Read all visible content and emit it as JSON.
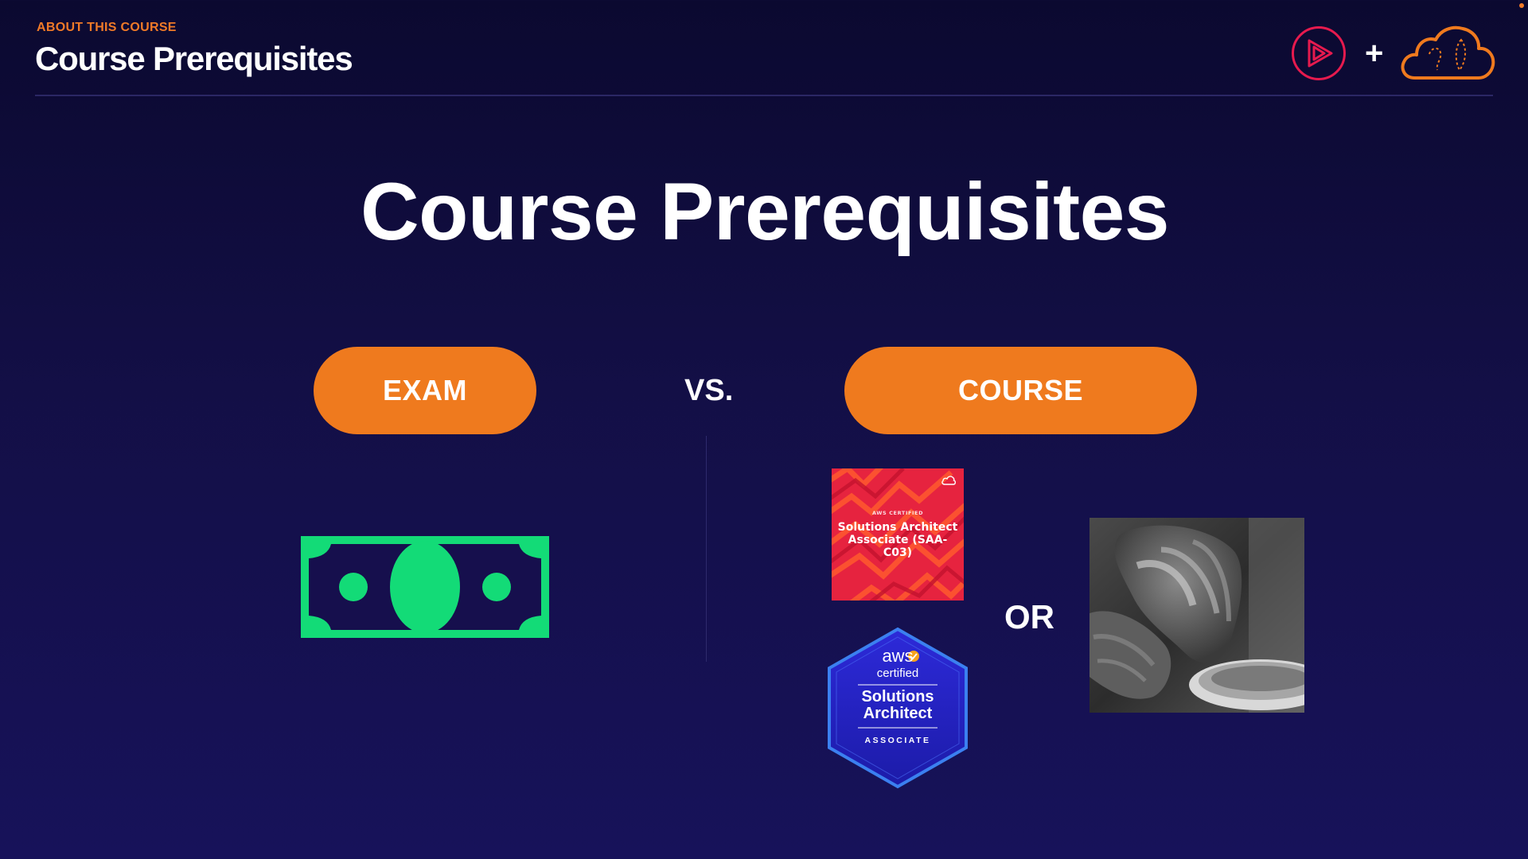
{
  "header": {
    "eyebrow": "ABOUT THIS COURSE",
    "title": "Course Prerequisites",
    "plus": "+"
  },
  "slide": {
    "title": "Course Prerequisites",
    "exam_label": "EXAM",
    "vs_label": "VS.",
    "course_label": "COURSE",
    "or_label": "OR"
  },
  "course_card": {
    "small_text": "AWS CERTIFIED",
    "title": "Solutions Architect Associate (SAA-C03)"
  },
  "badge": {
    "brand": "aws",
    "certified": "certified",
    "title": "Solutions Architect",
    "level": "ASSOCIATE"
  },
  "icons": {
    "logo_left": "pluralsight-play-logo",
    "logo_right": "cloud-guru-cloud-logo",
    "money": "dollar-bill-icon",
    "photo": "pottery-hands-photo"
  },
  "colors": {
    "accent_orange": "#ef7a1e",
    "money_green": "#13db77",
    "card_red": "#e6233f",
    "badge_blue": "#2a2fd6"
  }
}
